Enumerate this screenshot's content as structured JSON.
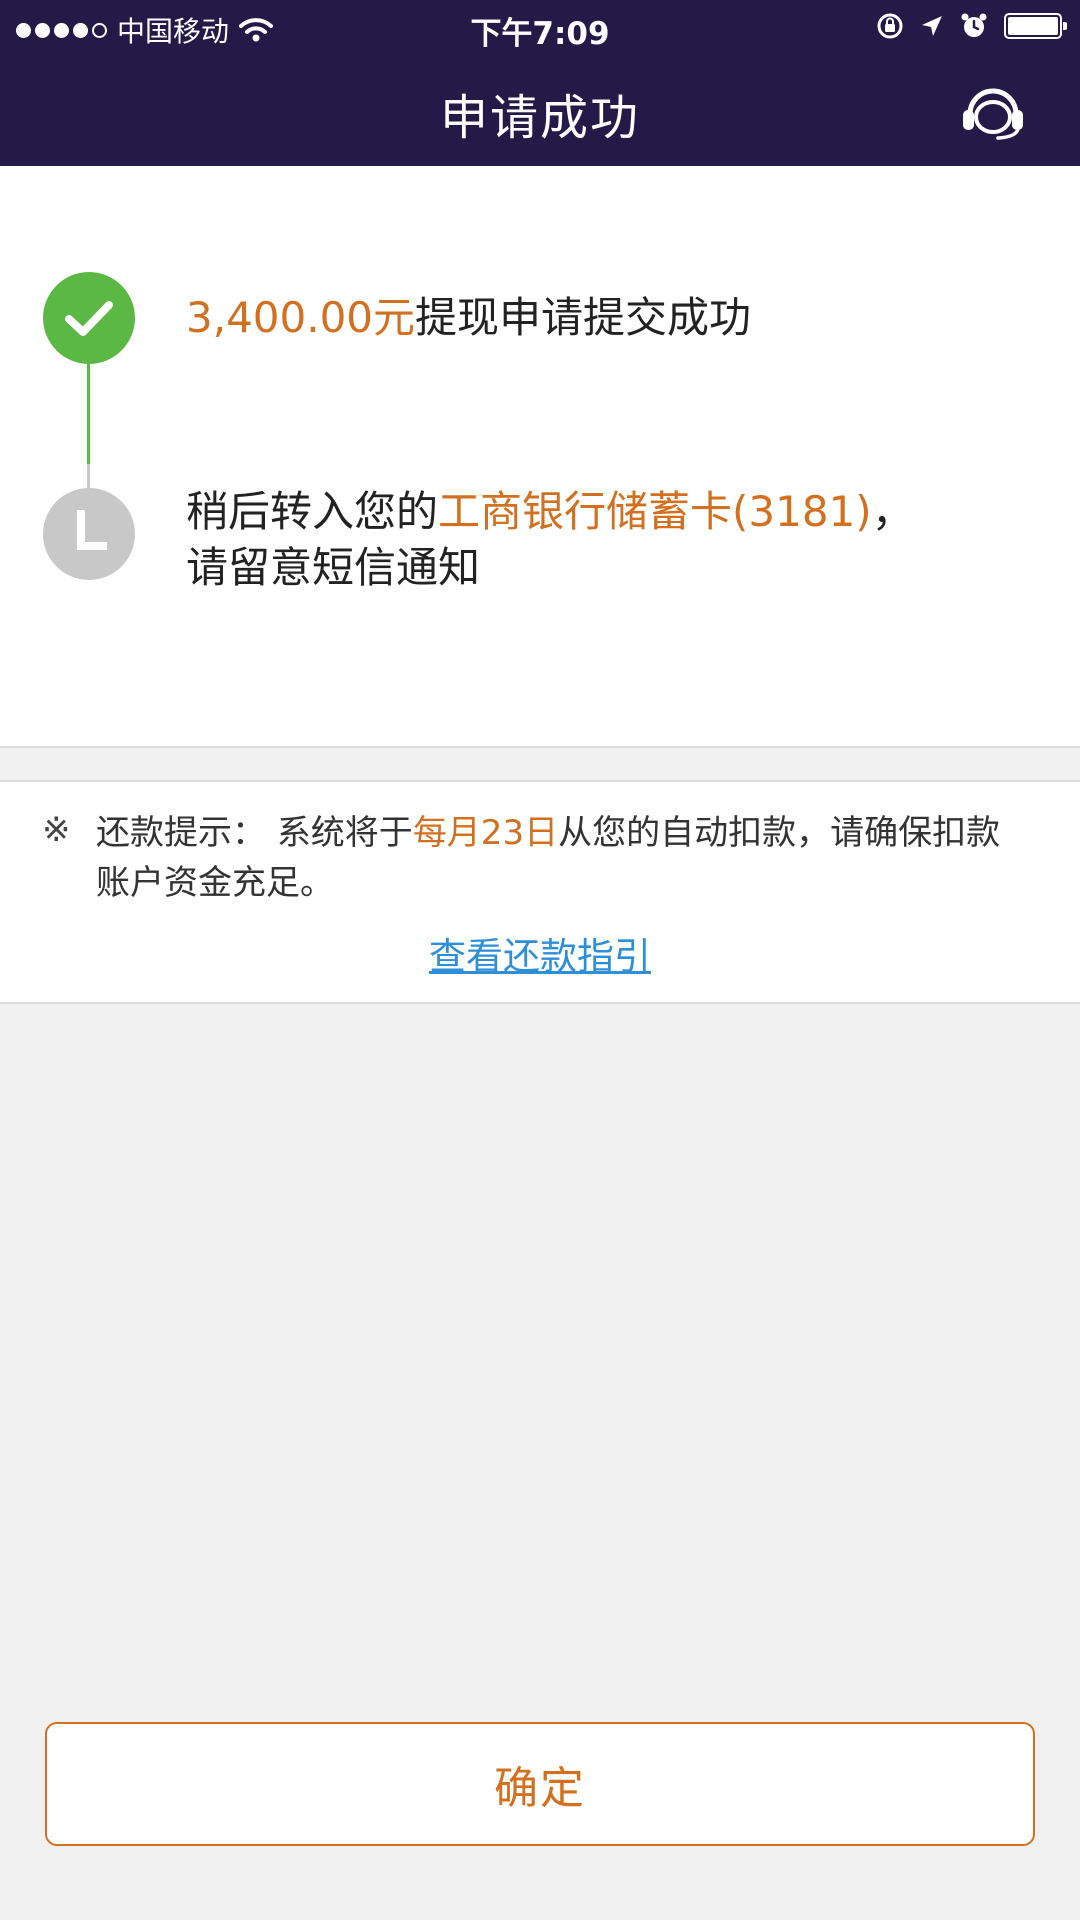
{
  "status_bar": {
    "carrier": "中国移动",
    "time": "下午7:09",
    "signal_bars_filled": 4,
    "signal_bars_total": 5,
    "battery_level": 1.0
  },
  "nav": {
    "title": "申请成功",
    "right_icon": "headset-icon"
  },
  "steps": [
    {
      "state": "done",
      "icon": "check-icon",
      "amount": "3,400.00元",
      "text": "提现申请提交成功"
    },
    {
      "state": "pending",
      "icon": "clock-icon",
      "text_before": "稍后转入您的",
      "highlight": "工商银行储蓄卡(3181)",
      "text_after": "，",
      "line2": "请留意短信通知"
    }
  ],
  "notice": {
    "mark": "※",
    "label": "还款提示：",
    "text_before": "系统将于",
    "highlight": "每月23日",
    "text_after": "从您的自动扣款，请确保扣款账户资金充足。",
    "link": "查看还款指引"
  },
  "confirm_button": "确定",
  "colors": {
    "header_bg": "#231a47",
    "accent_orange": "#d27020",
    "success_green": "#5cb845",
    "pending_grey": "#c8c8c8",
    "link_blue": "#2f8ed8",
    "page_bg": "#f0f0f0"
  }
}
